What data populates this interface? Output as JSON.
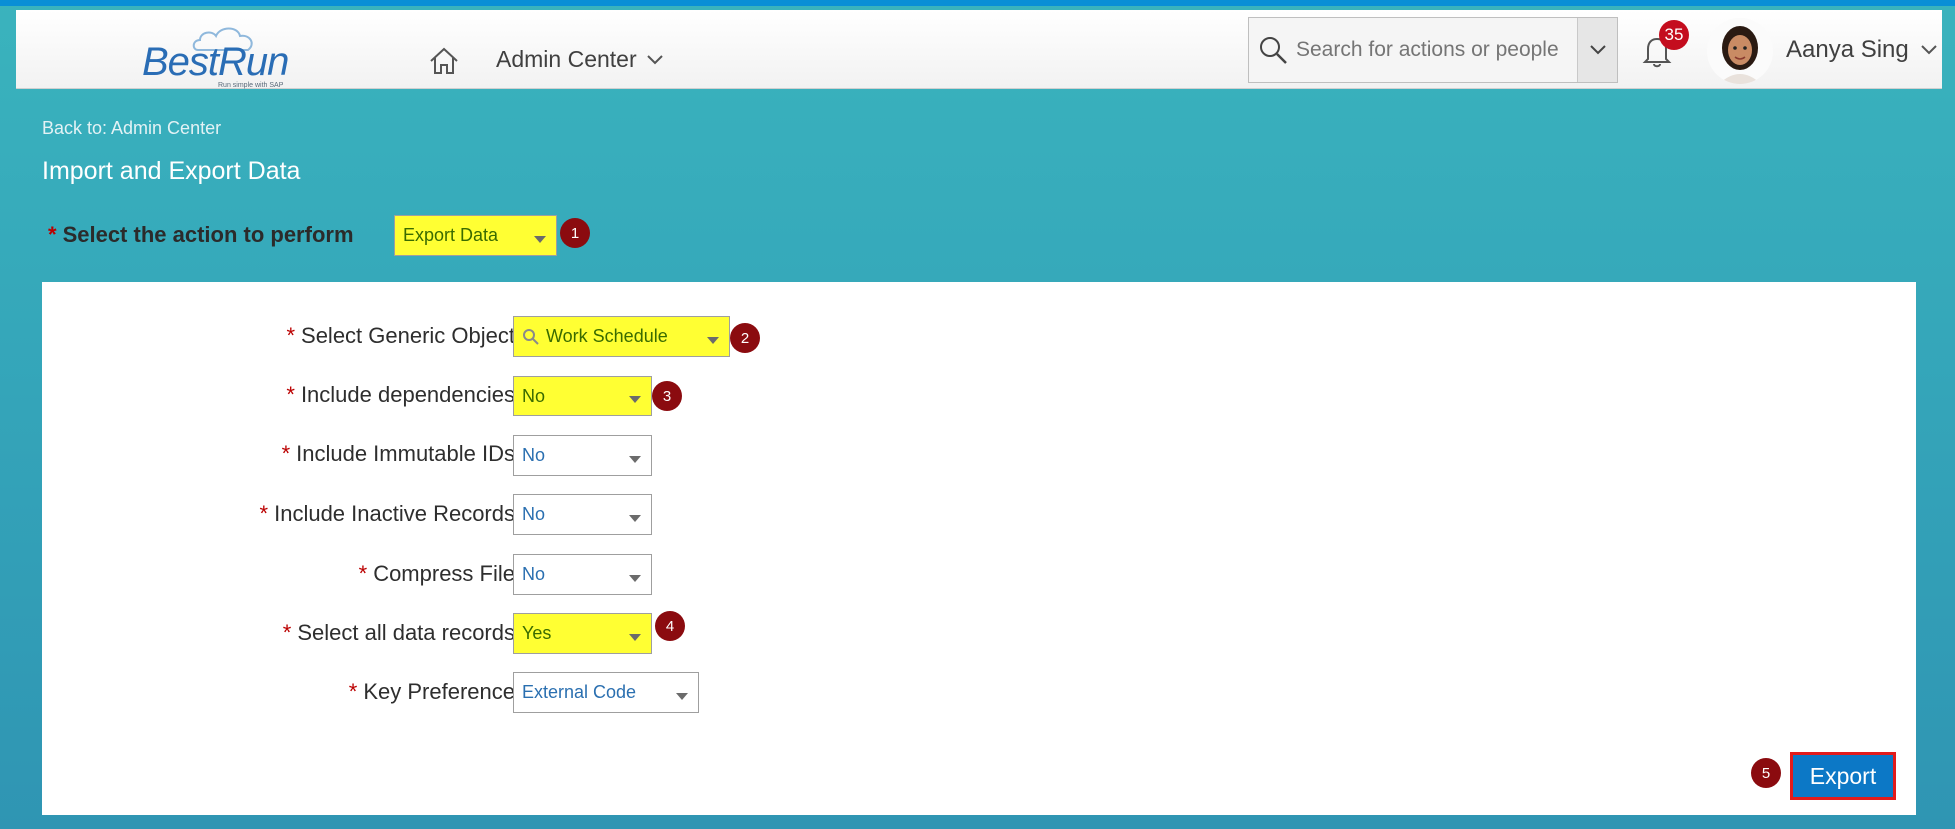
{
  "header": {
    "logo_text": "BestRun",
    "logo_tagline": "Run simple with SAP",
    "nav_label": "Admin Center",
    "search_placeholder": "Search for actions or people",
    "notification_count": "35",
    "user_name": "Aanya Sing"
  },
  "page": {
    "back_link": "Back to: Admin Center",
    "title": "Import and Export Data",
    "action_label": "Select the action to perform",
    "action_value": "Export Data"
  },
  "form": {
    "required_marker": "*",
    "fields": [
      {
        "label": "Select Generic Object",
        "value": "Work Schedule",
        "step": "2"
      },
      {
        "label": "Include dependencies",
        "value": "No",
        "step": "3"
      },
      {
        "label": "Include Immutable IDs",
        "value": "No"
      },
      {
        "label": "Include Inactive Records",
        "value": "No"
      },
      {
        "label": "Compress File",
        "value": "No"
      },
      {
        "label": "Select all data records",
        "value": "Yes",
        "step": "4"
      },
      {
        "label": "Key Preference",
        "value": "External Code"
      }
    ],
    "export_label": "Export"
  },
  "steps": {
    "s1": "1",
    "s5": "5"
  },
  "colors": {
    "highlight": "#ffff33",
    "accent": "#0c78c6",
    "step_badge": "#8b0b0f"
  }
}
